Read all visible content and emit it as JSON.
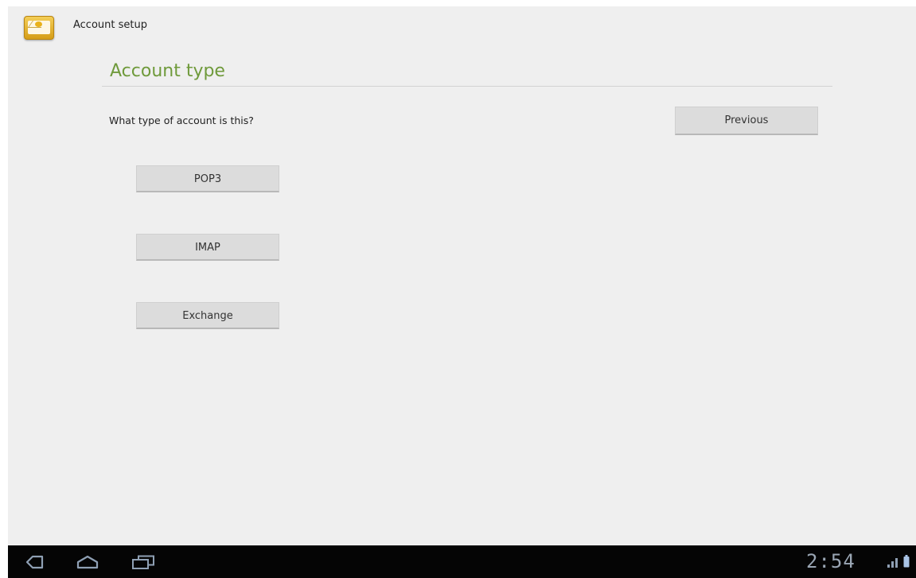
{
  "action_bar": {
    "app_icon": "email-app-icon",
    "title": "Account setup"
  },
  "main": {
    "heading": "Account type",
    "question": "What type of account is this?",
    "previous_label": "Previous",
    "account_types": [
      {
        "label": "POP3"
      },
      {
        "label": "IMAP"
      },
      {
        "label": "Exchange"
      }
    ]
  },
  "system_bar": {
    "icons": [
      "back-icon",
      "home-icon",
      "recent-apps-icon",
      "signal-icon",
      "battery-icon"
    ],
    "clock": "2:54"
  },
  "colors": {
    "heading_accent": "#6f9a3b",
    "background": "#efefef",
    "system_bar": "#050505"
  }
}
